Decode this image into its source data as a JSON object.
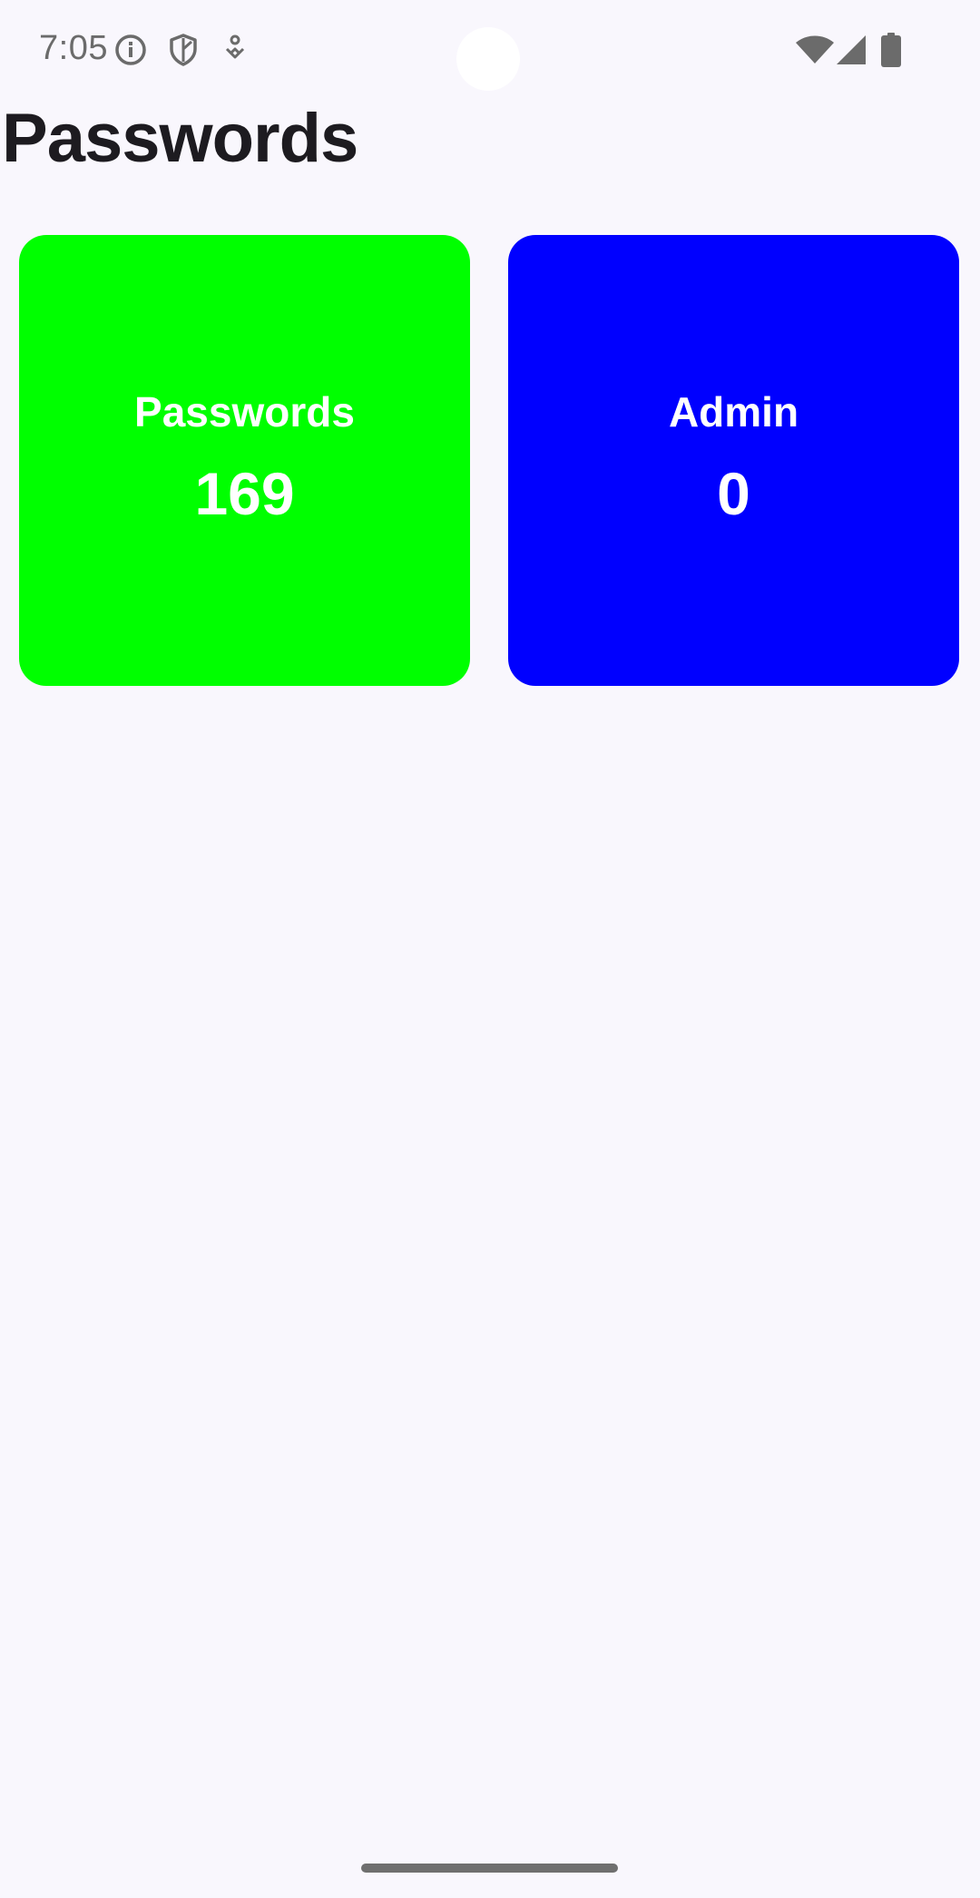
{
  "status_bar": {
    "time": "7:05",
    "icons": [
      "info-icon",
      "shield-icon",
      "accessibility-icon",
      "wifi-icon",
      "signal-icon",
      "battery-icon"
    ]
  },
  "page": {
    "title": "Passwords"
  },
  "cards": [
    {
      "label": "Passwords",
      "count": "169",
      "color": "#00ff00"
    },
    {
      "label": "Admin",
      "count": "0",
      "color": "#0000ff"
    }
  ],
  "colors": {
    "background": "#f9f7fd",
    "title_text": "#1d1b20",
    "card_text": "#ffffff",
    "status_icons": "#6b6b6b"
  }
}
